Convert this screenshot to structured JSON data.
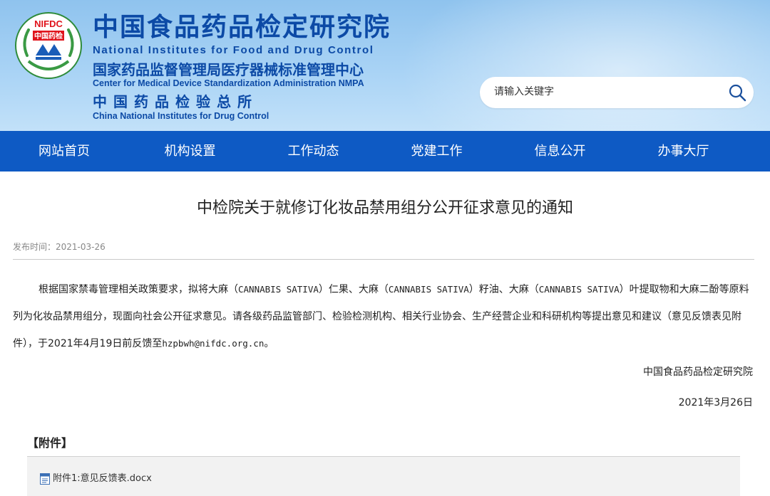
{
  "header": {
    "logo_text_top": "NIFDC",
    "logo_text_mid": "中国药检",
    "title_cn_1": "中国食品药品检定研究院",
    "title_en_1": "National Institutes for Food and Drug Control",
    "title_cn_2": "国家药品监督管理局医疗器械标准管理中心",
    "title_en_2": "Center for Medical Device Standardization Administration NMPA",
    "title_cn_3": "中国药品检验总所",
    "title_en_3": "China National Institutes for Drug Control"
  },
  "search": {
    "placeholder": "请输入关键字",
    "icon": "search-icon"
  },
  "nav": {
    "items": [
      {
        "label": "网站首页"
      },
      {
        "label": "机构设置"
      },
      {
        "label": "工作动态"
      },
      {
        "label": "党建工作"
      },
      {
        "label": "信息公开"
      },
      {
        "label": "办事大厅"
      }
    ]
  },
  "article": {
    "title": "中检院关于就修订化妆品禁用组分公开征求意见的通知",
    "publish_label": "发布时间：2021-03-26",
    "body_p1": "根据国家禁毒管理相关政策要求，拟将大麻（",
    "latin1": "CANNABIS SATIVA",
    "body_p2": "）仁果、大麻（",
    "latin2": "CANNABIS SATIVA",
    "body_p3": "）籽油、大麻（",
    "latin3": "CANNABIS SATIVA",
    "body_p4": "）叶提取物和大麻二酚等原料列为化妆品禁用组分，现面向社会公开征求意见。请各级药品监管部门、检验检测机构、相关行业协会、生产经营企业和科研机构等提出意见和建议（意见反馈表见附件），于2021年4月19日前反馈至",
    "email": "hzpbwh@nifdc.org.cn",
    "body_end": "。",
    "signature": "中国食品药品检定研究院",
    "date": "2021年3月26日"
  },
  "attachments": {
    "heading": "【附件】",
    "items": [
      {
        "label": "附件1:意见反馈表.docx",
        "icon": "word-document-icon"
      }
    ]
  },
  "colors": {
    "nav_bg": "#0e5ac4",
    "header_title": "#0c4aa6",
    "header_bg_top": "#8fc3ee",
    "header_bg_bottom": "#c2e1f9"
  }
}
